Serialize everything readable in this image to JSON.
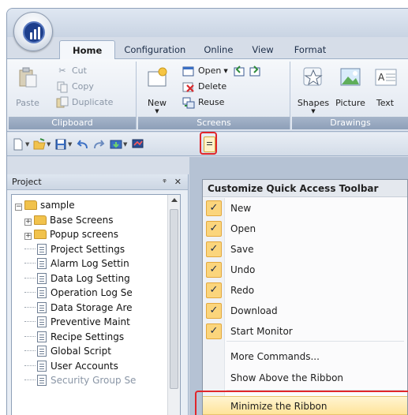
{
  "ribbon": {
    "tabs": [
      "Home",
      "Configuration",
      "Online",
      "View",
      "Format"
    ],
    "clipboard": {
      "group_label": "Clipboard",
      "paste": "Paste",
      "cut": "Cut",
      "copy": "Copy",
      "duplicate": "Duplicate"
    },
    "screens": {
      "group_label": "Screens",
      "new": "New",
      "open": "Open",
      "delete": "Delete",
      "reuse": "Reuse"
    },
    "drawings": {
      "group_label": "Drawings",
      "shapes": "Shapes",
      "picture": "Picture",
      "text": "Text"
    }
  },
  "project_panel": {
    "title": "Project",
    "pin_close": "ₐ ✕",
    "tree": [
      {
        "label": "sample",
        "level": 0,
        "icon": "folder-icon",
        "expander": "−"
      },
      {
        "label": "Base Screens",
        "level": 1,
        "icon": "folder-icon",
        "expander": "+"
      },
      {
        "label": "Popup screens",
        "level": 1,
        "icon": "folder-icon",
        "expander": "+"
      },
      {
        "label": "Project Settings",
        "level": 1,
        "icon": "document-icon"
      },
      {
        "label": "Alarm Log Settin",
        "level": 1,
        "icon": "document-icon"
      },
      {
        "label": "Data Log Setting",
        "level": 1,
        "icon": "document-icon"
      },
      {
        "label": "Operation Log Se",
        "level": 1,
        "icon": "document-icon"
      },
      {
        "label": "Data Storage Are",
        "level": 1,
        "icon": "document-icon"
      },
      {
        "label": "Preventive Maint",
        "level": 1,
        "icon": "document-icon"
      },
      {
        "label": "Recipe Settings",
        "level": 1,
        "icon": "document-icon"
      },
      {
        "label": "Global Script",
        "level": 1,
        "icon": "document-icon"
      },
      {
        "label": "User Accounts",
        "level": 1,
        "icon": "document-icon"
      },
      {
        "label": "Security Group Se",
        "level": 1,
        "icon": "document-icon",
        "disabled": true
      }
    ]
  },
  "menu": {
    "title": "Customize Quick Access Toolbar",
    "checked_items": [
      "New",
      "Open",
      "Save",
      "Undo",
      "Redo",
      "Download",
      "Start Monitor"
    ],
    "more_commands": "More Commands...",
    "show_above": "Show Above the Ribbon",
    "minimize": "Minimize the Ribbon"
  },
  "colors": {
    "highlight_red": "#e0262b",
    "check_bg": "#fbd57c",
    "ribbon_label": "#8d9fb8"
  }
}
